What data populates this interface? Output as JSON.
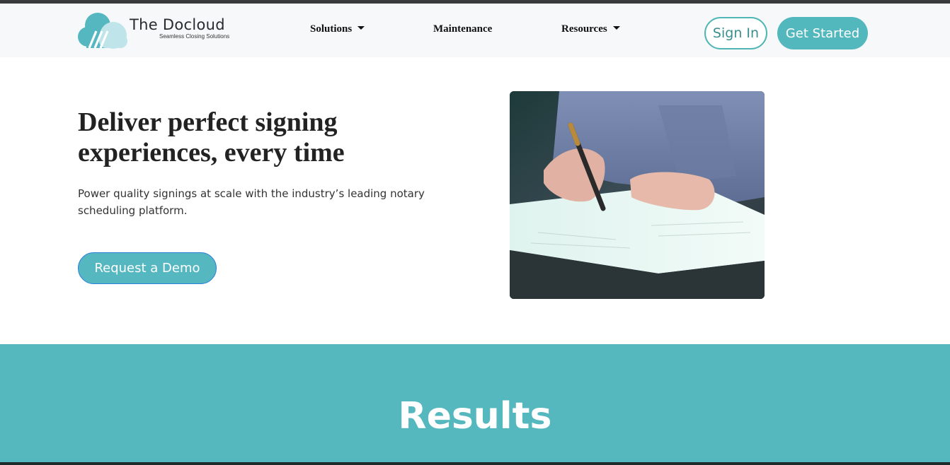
{
  "brand": {
    "name": "The Docloud",
    "tagline": "Seamless Closing Solutions"
  },
  "nav": {
    "items": [
      {
        "label": "Solutions",
        "has_dropdown": true
      },
      {
        "label": "Maintenance",
        "has_dropdown": false
      },
      {
        "label": "Resources",
        "has_dropdown": true
      }
    ],
    "sign_in_label": "Sign In",
    "get_started_label": "Get Started"
  },
  "hero": {
    "title": "Deliver perfect signing experiences, every time",
    "subtitle": "Power quality signings at scale with the industry’s leading notary scheduling platform.",
    "cta_label": "Request a Demo"
  },
  "results": {
    "title": "Results"
  },
  "colors": {
    "accent": "#53b8bd",
    "signin_border": "#4fb6b5",
    "navbar_bg": "#f6f8fa",
    "heading_text": "#222222"
  }
}
